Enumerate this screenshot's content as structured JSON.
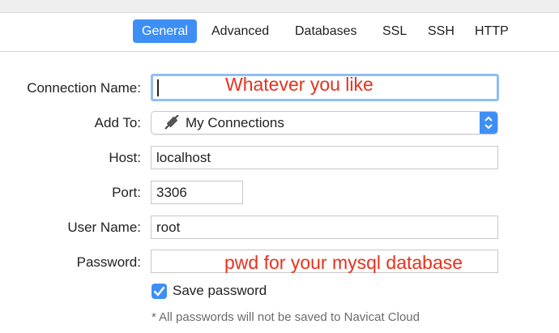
{
  "tabs": [
    {
      "label": "General",
      "active": true
    },
    {
      "label": "Advanced",
      "active": false
    },
    {
      "label": "Databases",
      "active": false
    },
    {
      "label": "SSL",
      "active": false
    },
    {
      "label": "SSH",
      "active": false
    },
    {
      "label": "HTTP",
      "active": false
    }
  ],
  "form": {
    "connection_name": {
      "label": "Connection Name:",
      "value": "",
      "annotation": "Whatever you like"
    },
    "add_to": {
      "label": "Add To:",
      "value": "My Connections",
      "icon": "connection-plug-icon"
    },
    "host": {
      "label": "Host:",
      "value": "localhost"
    },
    "port": {
      "label": "Port:",
      "value": "3306"
    },
    "user_name": {
      "label": "User Name:",
      "value": "root"
    },
    "password": {
      "label": "Password:",
      "value": "",
      "annotation": "pwd for your mysql database"
    },
    "save_password": {
      "label": "Save password",
      "checked": true
    },
    "note": "* All passwords will not be saved to Navicat Cloud"
  },
  "colors": {
    "accent": "#3d8ff5",
    "annotation": "#e6321e",
    "focus_ring": "#8fbef5"
  }
}
